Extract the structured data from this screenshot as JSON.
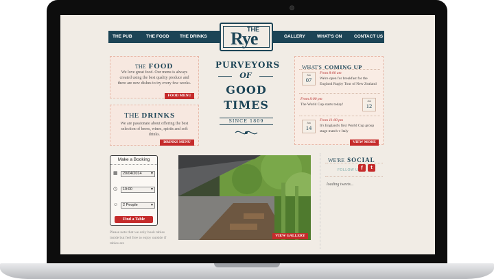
{
  "nav": {
    "items_left": [
      "THE PUB",
      "THE FOOD",
      "THE DRINKS"
    ],
    "items_right": [
      "GALLERY",
      "WHAT'S ON",
      "CONTACT US"
    ]
  },
  "logo": {
    "small": "THE",
    "main": "Rye"
  },
  "food": {
    "title_prefix": "THE",
    "title_main": "FOOD",
    "text": "We love great food. Our menu is always created using the best quality produce and there are new dishes to try every few weeks.",
    "button": "FOOD MENU"
  },
  "drinks": {
    "title_prefix": "THE",
    "title_main": "DRINKS",
    "text": "We are passionate about offering the best selection of beers, wines, spirits and soft drinks.",
    "button": "DRINKS MENU"
  },
  "tagline": {
    "line1": "PURVEYORS",
    "line2": "OF",
    "line3": "GOOD",
    "line4": "TIMES",
    "since": "SINCE 1809"
  },
  "coming_up": {
    "title_prefix": "WHAT'S",
    "title_main": "COMING UP",
    "events": [
      {
        "month": "Jun",
        "day": "07",
        "time": "From 8:00 am",
        "desc": "We're open for breakfast for the England Rugby Tour of New Zealand"
      },
      {
        "month": "Jun",
        "day": "12",
        "time": "From 8:00 pm",
        "desc": "The World Cup starts today!"
      },
      {
        "month": "Jun",
        "day": "14",
        "time": "From 11:00 pm",
        "desc": "It's England's first World Cup group stage match v Italy"
      }
    ],
    "button": "VIEW MORE"
  },
  "booking": {
    "title": "Make a Booking",
    "date": "20/04/2014",
    "time": "19:00",
    "people": "2 People",
    "button": "Find a Table",
    "note": "Please note that we only book tables inside but feel free to enjoy outside if tables are"
  },
  "gallery": {
    "button": "VIEW GALLERY"
  },
  "social": {
    "title_prefix": "WE'RE",
    "title_main": "SOCIAL",
    "follow": "FOLLOW US",
    "tweets": "loading tweets..."
  },
  "colors": {
    "navy": "#1c4456",
    "red": "#c52b2b",
    "cream": "#f1ece5",
    "pink": "#f7e8e0"
  },
  "icons": {
    "calendar": "calendar-icon",
    "clock": "clock-icon",
    "person": "person-icon",
    "facebook": "facebook-icon",
    "twitter": "twitter-icon"
  }
}
